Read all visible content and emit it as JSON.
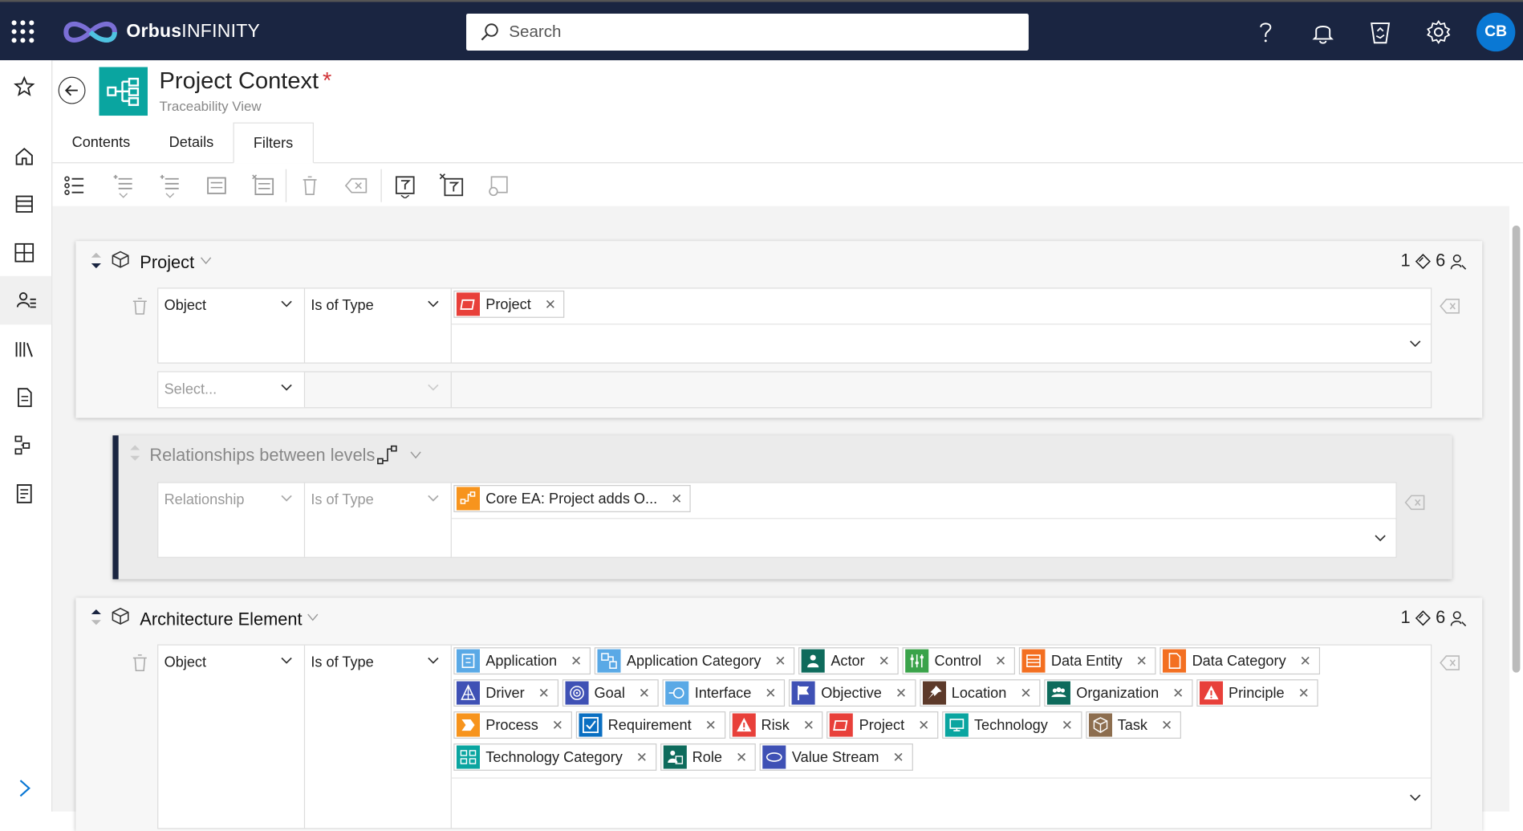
{
  "app": {
    "brand_bold": "Orbus",
    "brand_light": "INFINITY",
    "avatar_initials": "CB"
  },
  "search": {
    "placeholder": "Search"
  },
  "header": {
    "title": "Project Context",
    "required_mark": "*",
    "subtitle": "Traceability View"
  },
  "tabs": [
    {
      "label": "Contents",
      "active": false
    },
    {
      "label": "Details",
      "active": false
    },
    {
      "label": "Filters",
      "active": true
    }
  ],
  "level1": {
    "title": "Project",
    "count_a": "1",
    "count_b": "6",
    "row1": {
      "field": "Object",
      "operator": "Is of Type",
      "chips": [
        {
          "label": "Project",
          "icon": "project-icon",
          "color": "#e8403a"
        }
      ]
    },
    "row2": {
      "field_placeholder": "Select..."
    }
  },
  "relationship": {
    "title": "Relationships between levels",
    "field": "Relationship",
    "operator": "Is of Type",
    "chips": [
      {
        "label": "Core EA: Project adds O...",
        "icon": "relationship-icon",
        "color": "#f7941d"
      }
    ]
  },
  "level2": {
    "title": "Architecture Element",
    "count_a": "1",
    "count_b": "6",
    "field": "Object",
    "operator": "Is of Type",
    "chips": [
      {
        "label": "Application",
        "icon": "application-icon",
        "color": "#5aa9e6"
      },
      {
        "label": "Application Category",
        "icon": "application-category-icon",
        "color": "#5aa9e6"
      },
      {
        "label": "Actor",
        "icon": "actor-icon",
        "color": "#0e6b5c"
      },
      {
        "label": "Control",
        "icon": "control-icon",
        "color": "#3aa34a"
      },
      {
        "label": "Data Entity",
        "icon": "data-entity-icon",
        "color": "#f36f21"
      },
      {
        "label": "Data Category",
        "icon": "data-category-icon",
        "color": "#f36f21"
      },
      {
        "label": "Driver",
        "icon": "driver-icon",
        "color": "#3f51b5"
      },
      {
        "label": "Goal",
        "icon": "goal-icon",
        "color": "#3f51b5"
      },
      {
        "label": "Interface",
        "icon": "interface-icon",
        "color": "#5aa9e6"
      },
      {
        "label": "Objective",
        "icon": "objective-icon",
        "color": "#3f51b5"
      },
      {
        "label": "Location",
        "icon": "location-icon",
        "color": "#5d3a2a"
      },
      {
        "label": "Organization",
        "icon": "organization-icon",
        "color": "#0e6b5c"
      },
      {
        "label": "Principle",
        "icon": "principle-icon",
        "color": "#e8403a"
      },
      {
        "label": "Process",
        "icon": "process-icon",
        "color": "#f7941d"
      },
      {
        "label": "Requirement",
        "icon": "requirement-icon",
        "color": "#0a6fc2"
      },
      {
        "label": "Risk",
        "icon": "risk-icon",
        "color": "#e8403a"
      },
      {
        "label": "Project",
        "icon": "project-icon",
        "color": "#e8403a"
      },
      {
        "label": "Technology",
        "icon": "technology-icon",
        "color": "#0aa5a0"
      },
      {
        "label": "Task",
        "icon": "task-icon",
        "color": "#8d6e4f"
      },
      {
        "label": "Technology Category",
        "icon": "technology-category-icon",
        "color": "#0aa5a0"
      },
      {
        "label": "Role",
        "icon": "role-icon",
        "color": "#0e6b5c"
      },
      {
        "label": "Value Stream",
        "icon": "value-stream-icon",
        "color": "#3f51b5"
      }
    ]
  },
  "colors": {
    "topbar": "#1a2541",
    "accent_teal": "#0aa5a0",
    "avatar": "#0a78d4",
    "required": "#d13438"
  }
}
